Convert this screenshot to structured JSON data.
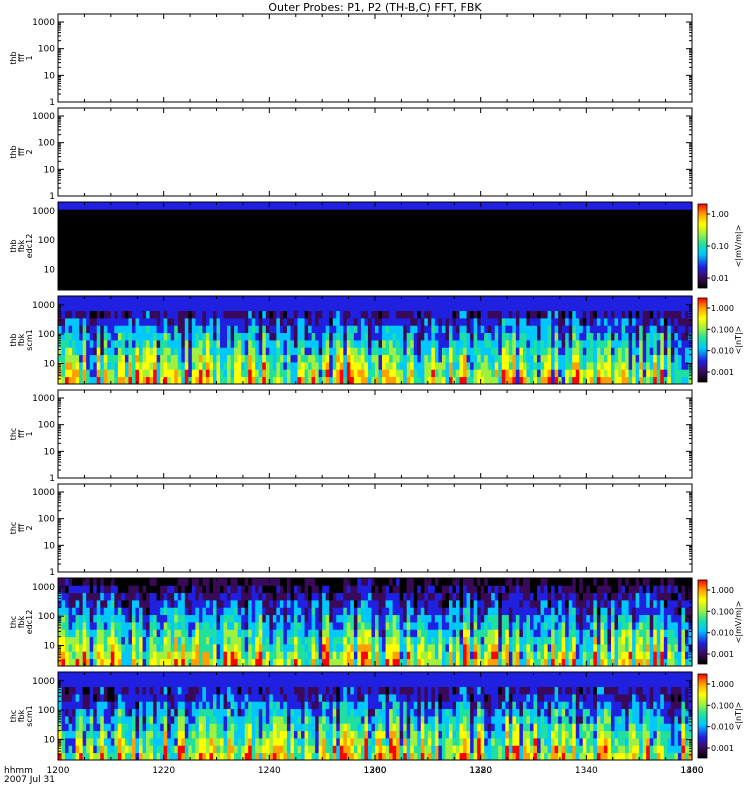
{
  "chart_data": {
    "type": "heatmap",
    "title": "Outer Probes: P1, P2 (TH-B,C) FFT, FBK",
    "x_axis": {
      "range": [
        1200,
        1400
      ],
      "ticks": [
        "1200",
        "1220",
        "1240",
        "1260",
        "1280",
        "1300",
        "1320",
        "1340",
        "1360",
        "1380",
        "1400"
      ],
      "label_line1": "hhmm",
      "label_line2": "2007 Jul 31"
    },
    "y_axis": {
      "scale": "log",
      "ticks": [
        "1",
        "10",
        "100",
        "1000"
      ]
    },
    "panels": [
      {
        "label": [
          "thb",
          "fff",
          "1"
        ],
        "ylim": [
          1,
          2000
        ],
        "type": "empty"
      },
      {
        "label": [
          "thb",
          "fff",
          "2"
        ],
        "ylim": [
          1,
          2000
        ],
        "type": "empty"
      },
      {
        "label": [
          "thb",
          "fbk",
          "edc12"
        ],
        "ylim": [
          2,
          2000
        ],
        "type": "spectrogram",
        "colorbar": {
          "label": "<|mV/m|>",
          "ticks": [
            "1.00",
            "0.10",
            "0.01"
          ],
          "scale": "log"
        }
      },
      {
        "label": [
          "thb",
          "fbk",
          "scm1"
        ],
        "ylim": [
          2,
          2000
        ],
        "type": "spectrogram",
        "colorbar": {
          "label": "<|nT|>",
          "ticks": [
            "1.000",
            "0.100",
            "0.010",
            "0.001"
          ],
          "scale": "log"
        }
      },
      {
        "label": [
          "thc",
          "fff",
          "1"
        ],
        "ylim": [
          1,
          2000
        ],
        "type": "empty"
      },
      {
        "label": [
          "thc",
          "fff",
          "2"
        ],
        "ylim": [
          1,
          2000
        ],
        "type": "empty"
      },
      {
        "label": [
          "thc",
          "fbk",
          "edc12"
        ],
        "ylim": [
          2,
          2000
        ],
        "type": "spectrogram",
        "colorbar": {
          "label": "<|mV/m|>",
          "ticks": [
            "1.000",
            "0.100",
            "0.010",
            "0.001"
          ],
          "scale": "log"
        }
      },
      {
        "label": [
          "thc",
          "fbk",
          "scm1"
        ],
        "ylim": [
          2,
          2000
        ],
        "type": "spectrogram",
        "colorbar": {
          "label": "<|nT|>",
          "ticks": [
            "1.000",
            "0.100",
            "0.010",
            "0.001"
          ],
          "scale": "log"
        }
      }
    ],
    "colors": {
      "scale": [
        "#000000",
        "#3a0a5a",
        "#2020e0",
        "#00c8ff",
        "#20e0a0",
        "#a0f040",
        "#ffff00",
        "#ffa000",
        "#ff0000"
      ]
    }
  }
}
